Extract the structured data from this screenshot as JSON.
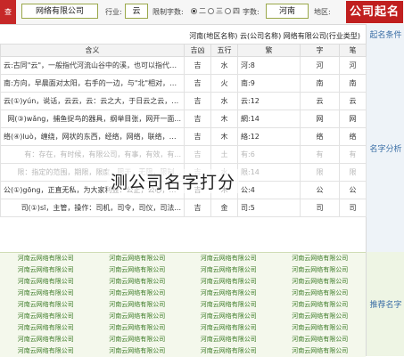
{
  "topbar": {
    "left_button": "查",
    "company_field": "网络有限公司",
    "industry_label": "行业:",
    "industry_value": "云",
    "count_label": "限制字数:",
    "radio_options": [
      "二",
      "三",
      "四"
    ],
    "selected_radio": 0,
    "pinyin_label": "字数:",
    "region_label": "地区:",
    "region_value": "河南",
    "logo_text": "公司起名"
  },
  "side_labels": {
    "top": "起名条件",
    "middle": "名字分析",
    "bottom": "推荐名字"
  },
  "info_strip": "河南(地区名称) 云(公司名称) 网络有限公司(行业类型)",
  "table": {
    "headers": [
      "含义",
      "吉凶",
      "五行",
      "繁",
      "字",
      "笔"
    ],
    "rows": [
      {
        "meaning": "云:古同\"云\"，一般指代河流山谷中的溪，也可以指代云彩的白云，人的...",
        "luck": "吉",
        "element": "水",
        "trad": "河:8",
        "char": "河",
        "strokes": "河"
      },
      {
        "meaning": "南:方向，早晨面对太阳，右手的一边，与\"北\"相对，南极...",
        "luck": "吉",
        "element": "火",
        "trad": "南:9",
        "char": "南",
        "strokes": "南"
      },
      {
        "meaning": "云(①)yún，说话，云云，云：云之大，于日云之云，云...",
        "luck": "吉",
        "element": "水",
        "trad": "云:12",
        "char": "云",
        "strokes": "云"
      },
      {
        "meaning": "网(③)wǎng，捕鱼捉鸟的器具，纲举目张，网开一面...",
        "luck": "吉",
        "element": "木",
        "trad": "網:14",
        "char": "网",
        "strokes": "网"
      },
      {
        "meaning": "络(④)luò，缠绕，网状的东西，经络，网络，联络，笼络...",
        "luck": "吉",
        "element": "木",
        "trad": "絡:12",
        "char": "络",
        "strokes": "络"
      },
      {
        "meaning": "有：存在，有时候，有限公司，有事，有效，有...",
        "luck": "吉",
        "element": "土",
        "trad": "有:6",
        "char": "有",
        "strokes": "有",
        "faded": true
      },
      {
        "meaning": "限：指定的范围，期限，限度，限于，无限，限制...",
        "luck": "吉",
        "element": "水",
        "trad": "限:14",
        "char": "限",
        "strokes": "限",
        "faded": true
      },
      {
        "meaning": "公(①)gōng，正直无私，为大家利益：公正，公心，大公无私...",
        "luck": "吉",
        "element": "木",
        "trad": "公:4",
        "char": "公",
        "strokes": "公"
      },
      {
        "meaning": "司(①)sī，主管，操作：司机，司令，司仪，司法...",
        "luck": "吉",
        "element": "金",
        "trad": "司:5",
        "char": "司",
        "strokes": "司"
      }
    ]
  },
  "watermark": "测公司名字打分",
  "results": [
    [
      "河南云网络有限公司",
      "河南云网络有限公司",
      "河南云网络有限公司",
      "河南云网络有限公司"
    ],
    [
      "河南云网络有限公司",
      "河南云网络有限公司",
      "河南云网络有限公司",
      "河南云网络有限公司"
    ],
    [
      "河南云网络有限公司",
      "河南云网络有限公司",
      "河南云网络有限公司",
      "河南云网络有限公司"
    ],
    [
      "河南云网络有限公司",
      "河南云网络有限公司",
      "河南云网络有限公司",
      "河南云网络有限公司"
    ],
    [
      "河南云网络有限公司",
      "河南云网络有限公司",
      "河南云网络有限公司",
      "河南云网络有限公司"
    ],
    [
      "河南云网络有限公司",
      "河南云网络有限公司",
      "河南云网络有限公司",
      "河南云网络有限公司"
    ],
    [
      "河南云网络有限公司",
      "河南云网络有限公司",
      "河南云网络有限公司",
      "河南云网络有限公司"
    ],
    [
      "河南云网络有限公司",
      "河南云网络有限公司",
      "河南云网络有限公司",
      "河南云网络有限公司"
    ],
    [
      "河南云网络有限公司",
      "河南云网络有限公司",
      "河南云网络有限公司",
      "河南云网络有限公司"
    ]
  ],
  "colors": {
    "brand_red": "#c01f1f",
    "side_blue": "#3a6ea5",
    "result_green": "#3f7d2a"
  }
}
